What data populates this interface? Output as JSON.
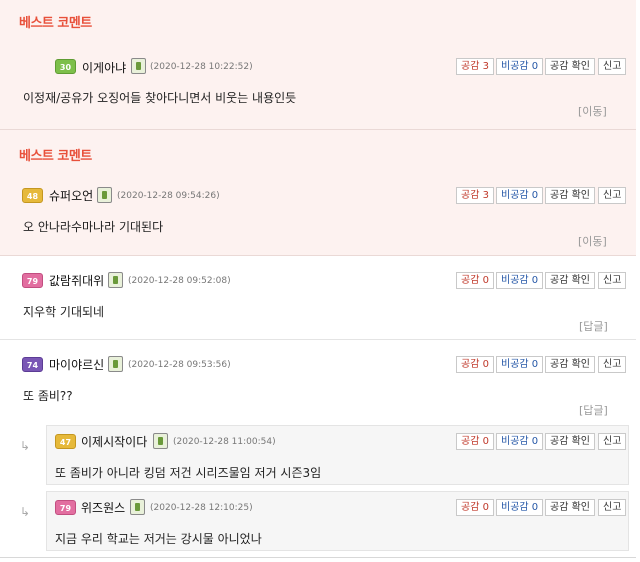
{
  "best_label": {
    "part1": "베스트",
    "part2": "코멘트"
  },
  "buttons": {
    "agree": "공감",
    "disagree": "비공감",
    "check": "공감 확인",
    "report": "신고"
  },
  "links": {
    "move": "[이동]",
    "reply": "[답글]"
  },
  "comments": [
    {
      "nick": "이게아냐",
      "level": "30",
      "date": "(2020-12-28 10:22:52)",
      "text": "이정재/공유가 오징어들 찾아다니면서 비웃는 내용인듯",
      "agree": "3",
      "disagree": "0"
    },
    {
      "nick": "슈퍼오언",
      "level": "48",
      "date": "(2020-12-28 09:54:26)",
      "text": "오 안나라수마나라 기대된다",
      "agree": "3",
      "disagree": "0"
    },
    {
      "nick": "값람쥐대위",
      "level": "79",
      "date": "(2020-12-28 09:52:08)",
      "text": "지우학 기대되네",
      "agree": "0",
      "disagree": "0"
    },
    {
      "nick": "마이야르신",
      "level": "74",
      "date": "(2020-12-28 09:53:56)",
      "text": "또 좀비??",
      "agree": "0",
      "disagree": "0"
    },
    {
      "nick": "이제시작이다",
      "level": "47",
      "date": "(2020-12-28 11:00:54)",
      "text": "또 좀비가 아니라 킹덤 저건 시리즈물임 저거 시즌3임",
      "agree": "0",
      "disagree": "0"
    },
    {
      "nick": "위즈원스",
      "level": "79",
      "date": "(2020-12-28 12:10:25)",
      "text": "지금 우리 학교는 저거는 강시물 아니었나",
      "agree": "0",
      "disagree": "0"
    }
  ],
  "colors": {
    "best_bg": "#fdf2f0",
    "best_title": "#e8503a",
    "agree": "#c0392b",
    "disagree": "#2557a7"
  }
}
